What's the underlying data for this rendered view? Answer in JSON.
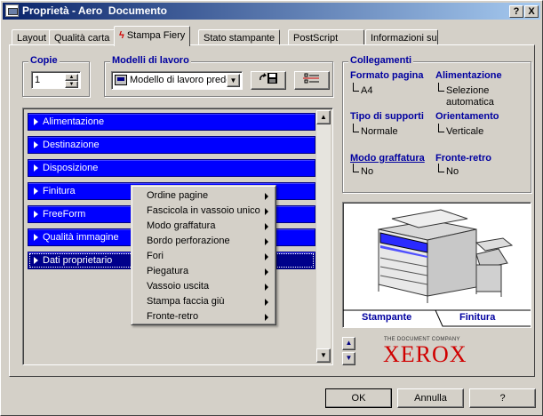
{
  "window": {
    "title": "Proprietà - Aero  Documento",
    "buttons": {
      "help": "?",
      "close": "X"
    }
  },
  "tabs": [
    {
      "label": "Layout"
    },
    {
      "label": "Qualità carta"
    },
    {
      "label": "Stampa Fiery",
      "active": true,
      "icon": "flash-icon"
    },
    {
      "label": "Stato stampante"
    },
    {
      "label": "PostScript"
    },
    {
      "label": "Informazioni su"
    }
  ],
  "copies": {
    "legend": "Copie",
    "value": "1"
  },
  "templates": {
    "legend": "Modelli di lavoro",
    "selected": "Modello di lavoro predefinito"
  },
  "settings_list": [
    {
      "label": "Alimentazione"
    },
    {
      "label": "Destinazione"
    },
    {
      "label": "Disposizione"
    },
    {
      "label": "Finitura"
    },
    {
      "label": "FreeForm"
    },
    {
      "label": "Qualità immagine"
    },
    {
      "label": "Dati proprietario",
      "selected": true
    }
  ],
  "context_menu": [
    "Ordine pagine",
    "Fascicola in vassoio unico",
    "Modo graffatura",
    "Bordo perforazione",
    "Fori",
    "Piegatura",
    "Vassoio uscita",
    "Stampa faccia giù",
    "Fronte-retro"
  ],
  "links": {
    "legend": "Collegamenti",
    "items": [
      {
        "title": "Formato pagina",
        "value": "A4"
      },
      {
        "title": "Alimentazione",
        "value": "Selezione",
        "value2": "automatica"
      },
      {
        "title": "Tipo di supporti",
        "value": "Normale"
      },
      {
        "title": "Orientamento",
        "value": "Verticale"
      },
      {
        "title": "Modo graffatura",
        "value": "No",
        "underline": true
      },
      {
        "title": "Fronte-retro",
        "value": "No"
      }
    ]
  },
  "printer_tabs": {
    "left": "Stampante",
    "right": "Finitura"
  },
  "brand": {
    "tagline": "THE DOCUMENT COMPANY",
    "name": "XEROX"
  },
  "footer": {
    "ok": "OK",
    "cancel": "Annulla",
    "help": "?"
  },
  "colors": {
    "bar_blue": "#0000ff",
    "title_blue": "#0000a0",
    "brand_red": "#d00000"
  }
}
